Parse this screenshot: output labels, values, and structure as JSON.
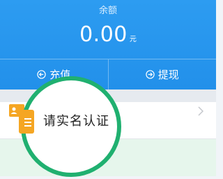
{
  "wallet": {
    "balance_label": "余额",
    "balance_amount": "0.00",
    "balance_unit": "元",
    "actions": [
      {
        "label": "充值",
        "icon": "recharge-icon"
      },
      {
        "label": "提现",
        "icon": "withdraw-icon"
      }
    ]
  },
  "menu": {
    "items": [
      {
        "label": "请实名认证",
        "icon": "id-card-icon"
      }
    ]
  },
  "colors": {
    "header_blue": "#2290ea",
    "accent_orange": "#f5a623",
    "magnifier_green": "#20b070"
  }
}
